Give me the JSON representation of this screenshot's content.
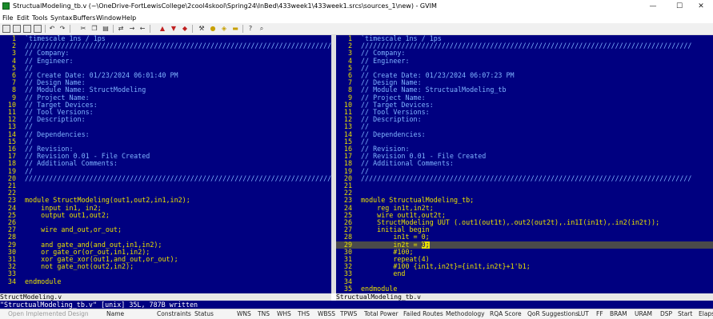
{
  "window": {
    "title": "StructualModeling_tb.v (~\\OneDrive-FortLewisCollege\\2cool4skool\\Spring24\\InBed\\433week1\\433week1.srcs\\sources_1\\new) - GVIM",
    "minimize_glyph": "—",
    "maximize_glyph": "☐",
    "close_glyph": "✕"
  },
  "menu": {
    "items": [
      "File",
      "Edit",
      "Tools",
      "Syntax",
      "Buffers",
      "Window",
      "Help"
    ]
  },
  "toolbar": {
    "icons": [
      "open-icon",
      "save-icon",
      "save-all-icon",
      "print-icon",
      "undo-icon",
      "redo-icon",
      "cut-icon",
      "copy-icon",
      "paste-icon",
      "find-replace-icon",
      "find-next-icon",
      "find-prev-icon",
      "load-session-icon",
      "save-session-icon",
      "run-script-icon",
      "make-icon",
      "run-shell-icon",
      "tags-icon",
      "jump-tag-icon",
      "help-icon",
      "find-help-icon"
    ]
  },
  "left_pane": {
    "lines": [
      [
        {
          "t": "`timescale 1ns / 1ps",
          "c": "comment"
        }
      ],
      [
        {
          "t": "//////////////////////////////////////////////////////////////////////////////////",
          "c": "comment"
        }
      ],
      [
        {
          "t": "// Company:",
          "c": "comment"
        }
      ],
      [
        {
          "t": "// Engineer:",
          "c": "comment"
        }
      ],
      [
        {
          "t": "//",
          "c": "comment"
        }
      ],
      [
        {
          "t": "// Create Date: 01/23/2024 06:01:40 PM",
          "c": "comment"
        }
      ],
      [
        {
          "t": "// Design Name:",
          "c": "comment"
        }
      ],
      [
        {
          "t": "// Module Name: StructModeling",
          "c": "comment"
        }
      ],
      [
        {
          "t": "// Project Name:",
          "c": "comment"
        }
      ],
      [
        {
          "t": "// Target Devices:",
          "c": "comment"
        }
      ],
      [
        {
          "t": "// Tool Versions:",
          "c": "comment"
        }
      ],
      [
        {
          "t": "// Description:",
          "c": "comment"
        }
      ],
      [
        {
          "t": "//",
          "c": "comment"
        }
      ],
      [
        {
          "t": "// Dependencies:",
          "c": "comment"
        }
      ],
      [
        {
          "t": "//",
          "c": "comment"
        }
      ],
      [
        {
          "t": "// Revision:",
          "c": "comment"
        }
      ],
      [
        {
          "t": "// Revision 0.01 - File Created",
          "c": "comment"
        }
      ],
      [
        {
          "t": "// Additional Comments:",
          "c": "comment"
        }
      ],
      [
        {
          "t": "//",
          "c": "comment"
        }
      ],
      [
        {
          "t": "//////////////////////////////////////////////////////////////////////////////////",
          "c": "comment"
        }
      ],
      [],
      [],
      [
        {
          "t": "module",
          "c": "keyword"
        },
        {
          "t": " StructModeling(out1,out2,in1,in2);",
          "c": "keyword"
        }
      ],
      [
        {
          "t": "    ",
          "c": "plain"
        },
        {
          "t": "input",
          "c": "keyword"
        },
        {
          "t": " in1, in2;",
          "c": "keyword"
        }
      ],
      [
        {
          "t": "    ",
          "c": "plain"
        },
        {
          "t": "output",
          "c": "keyword"
        },
        {
          "t": " out1,out2;",
          "c": "keyword"
        }
      ],
      [],
      [
        {
          "t": "    ",
          "c": "plain"
        },
        {
          "t": "wire",
          "c": "keyword"
        },
        {
          "t": " and_out,or_out;",
          "c": "keyword"
        }
      ],
      [],
      [
        {
          "t": "    ",
          "c": "plain"
        },
        {
          "t": "and",
          "c": "keyword"
        },
        {
          "t": " gate_and(and_out,in1,in2);",
          "c": "keyword"
        }
      ],
      [
        {
          "t": "    ",
          "c": "plain"
        },
        {
          "t": "or",
          "c": "keyword"
        },
        {
          "t": " gate_or(or_out,in1,in2);",
          "c": "keyword"
        }
      ],
      [
        {
          "t": "    ",
          "c": "plain"
        },
        {
          "t": "xor",
          "c": "keyword"
        },
        {
          "t": " gate_xor(out1,and_out,or_out);",
          "c": "keyword"
        }
      ],
      [
        {
          "t": "    ",
          "c": "plain"
        },
        {
          "t": "not",
          "c": "keyword"
        },
        {
          "t": " gate_not(out2,in2);",
          "c": "keyword"
        }
      ],
      [],
      [
        {
          "t": "endmodule",
          "c": "keyword"
        }
      ]
    ],
    "status": "StructModeling.v"
  },
  "right_pane": {
    "lines": [
      [
        {
          "t": "`timescale 1ns / 1ps",
          "c": "comment"
        }
      ],
      [
        {
          "t": "//////////////////////////////////////////////////////////////////////////////////",
          "c": "comment"
        }
      ],
      [
        {
          "t": "// Company:",
          "c": "comment"
        }
      ],
      [
        {
          "t": "// Engineer:",
          "c": "comment"
        }
      ],
      [
        {
          "t": "//",
          "c": "comment"
        }
      ],
      [
        {
          "t": "// Create Date: 01/23/2024 06:07:23 PM",
          "c": "comment"
        }
      ],
      [
        {
          "t": "// Design Name:",
          "c": "comment"
        }
      ],
      [
        {
          "t": "// Module Name: StructualModeling_tb",
          "c": "comment"
        }
      ],
      [
        {
          "t": "// Project Name:",
          "c": "comment"
        }
      ],
      [
        {
          "t": "// Target Devices:",
          "c": "comment"
        }
      ],
      [
        {
          "t": "// Tool Versions:",
          "c": "comment"
        }
      ],
      [
        {
          "t": "// Description:",
          "c": "comment"
        }
      ],
      [
        {
          "t": "//",
          "c": "comment"
        }
      ],
      [
        {
          "t": "// Dependencies:",
          "c": "comment"
        }
      ],
      [
        {
          "t": "//",
          "c": "comment"
        }
      ],
      [
        {
          "t": "// Revision:",
          "c": "comment"
        }
      ],
      [
        {
          "t": "// Revision 0.01 - File Created",
          "c": "comment"
        }
      ],
      [
        {
          "t": "// Additional Comments:",
          "c": "comment"
        }
      ],
      [
        {
          "t": "//",
          "c": "comment"
        }
      ],
      [
        {
          "t": "//////////////////////////////////////////////////////////////////////////////////",
          "c": "comment"
        }
      ],
      [],
      [],
      [
        {
          "t": "module",
          "c": "keyword"
        },
        {
          "t": " StructualModeling_tb;",
          "c": "keyword"
        }
      ],
      [
        {
          "t": "    ",
          "c": "plain"
        },
        {
          "t": "reg",
          "c": "keyword"
        },
        {
          "t": " in1t,in2t;",
          "c": "keyword"
        }
      ],
      [
        {
          "t": "    ",
          "c": "plain"
        },
        {
          "t": "wire",
          "c": "keyword"
        },
        {
          "t": " out1t,out2t;",
          "c": "keyword"
        }
      ],
      [
        {
          "t": "    StructModeling UUT (.out1(out1t),.out2(out2t),.in1I(in1t),.in2(in2t));",
          "c": "keyword"
        }
      ],
      [
        {
          "t": "    ",
          "c": "plain"
        },
        {
          "t": "initial begin",
          "c": "keyword"
        }
      ],
      [
        {
          "t": "        in1t = 0;",
          "c": "keyword"
        }
      ],
      [
        {
          "t": "        in2t = ",
          "c": "keyword"
        },
        {
          "t": "0;",
          "c": "cursor"
        }
      ],
      [
        {
          "t": "        ",
          "c": "plain"
        },
        {
          "t": "#100;",
          "c": "keyword"
        }
      ],
      [
        {
          "t": "        ",
          "c": "plain"
        },
        {
          "t": "repeat(4)",
          "c": "keyword"
        }
      ],
      [
        {
          "t": "        ",
          "c": "plain"
        },
        {
          "t": "#100 {in1t,in2t}={in1t,in2t}+1'b1;",
          "c": "keyword"
        }
      ],
      [
        {
          "t": "        ",
          "c": "plain"
        },
        {
          "t": "end",
          "c": "keyword"
        }
      ],
      [],
      [
        {
          "t": "endmodule",
          "c": "keyword"
        }
      ]
    ],
    "cursor_line": 29,
    "status": "StructualModeling_tb.v"
  },
  "command_line": "\"StructualModeling_tb.v\" [unix] 35L, 787B written",
  "bottom_strip": {
    "left_text": "Open Implemented Design",
    "columns": [
      "Name",
      "Constraints",
      "Status",
      "WNS",
      "TNS",
      "WHS",
      "THS",
      "WBSS",
      "TPWS",
      "Total Power",
      "Failed Routes",
      "Methodology",
      "RQA Score",
      "QoR Suggestions",
      "LUT",
      "FF",
      "BRAM",
      "URAM",
      "DSP",
      "Start",
      "Elaps"
    ]
  },
  "colors": {
    "editor_bg": "#000080",
    "comment": "#7fb4ff",
    "keyword": "#e8e000",
    "line_number": "#e8e000"
  }
}
